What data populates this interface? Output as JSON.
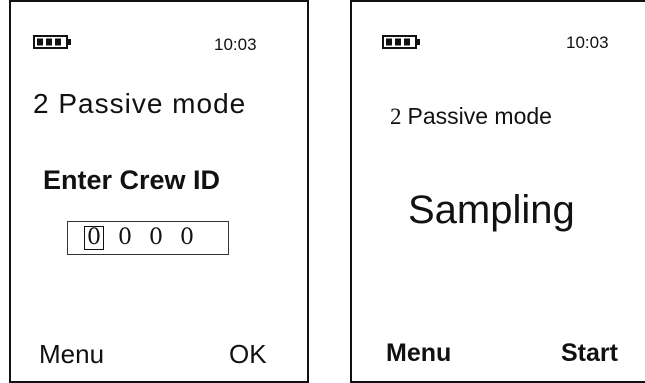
{
  "left_screen": {
    "time": "10:03",
    "mode": "2 Passive mode",
    "prompt": "Enter Crew ID",
    "crew_id_digits": [
      "0",
      "0",
      "0",
      "0"
    ],
    "softkeys": {
      "left": "Menu",
      "right": "OK"
    }
  },
  "right_screen": {
    "time": "10:03",
    "mode_number": "2",
    "mode_label": "Passive mode",
    "status": "Sampling",
    "softkeys": {
      "left": "Menu",
      "right": "Start"
    }
  },
  "icons": {
    "battery": "battery-full-icon"
  },
  "colors": {
    "foreground": "#111111",
    "background": "#ffffff"
  }
}
